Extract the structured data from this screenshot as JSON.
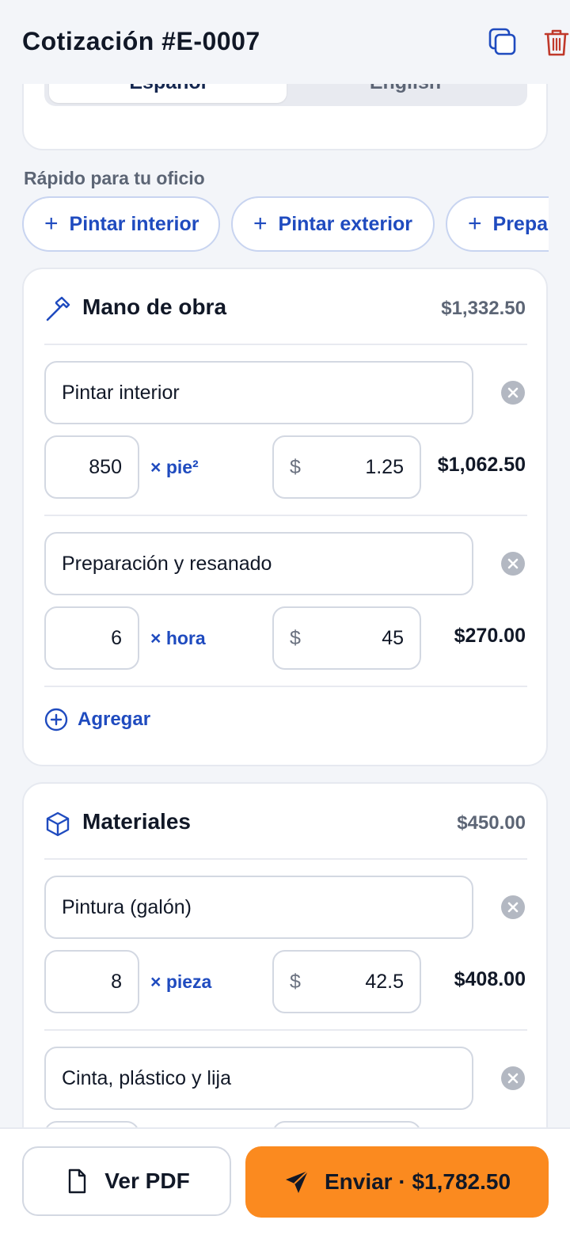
{
  "header": {
    "title": "Cotización #E-0007",
    "copy_icon": "copy-icon",
    "delete_icon": "trash-icon"
  },
  "language": {
    "active": "Español",
    "other": "English"
  },
  "quick": {
    "label": "Rápido para tu oficio",
    "chips": [
      "Pintar interior",
      "Pintar exterior",
      "Prepa"
    ]
  },
  "labor": {
    "title": "Mano de obra",
    "total": "$1,332.50",
    "icon": "hammer-icon",
    "items": [
      {
        "description": "Pintar interior",
        "qty": "850",
        "unit": "× pie²",
        "currency": "$",
        "price": "1.25",
        "total": "$1,062.50"
      },
      {
        "description": "Preparación y resanado",
        "qty": "6",
        "unit": "× hora",
        "currency": "$",
        "price": "45",
        "total": "$270.00"
      }
    ],
    "add_label": "Agregar"
  },
  "materials": {
    "title": "Materiales",
    "total": "$450.00",
    "icon": "box-icon",
    "items": [
      {
        "description": "Pintura (galón)",
        "qty": "8",
        "unit": "× pieza",
        "currency": "$",
        "price": "42.5",
        "total": "$408.00"
      },
      {
        "description": "Cinta, plástico y lija"
      }
    ]
  },
  "footer": {
    "pdf_label": "Ver PDF",
    "send_label": "Enviar · $1,782.50"
  },
  "colors": {
    "accent": "#1f4bbf",
    "send": "#fb8a1f",
    "danger": "#c0392b",
    "background": "#f3f5f9"
  }
}
